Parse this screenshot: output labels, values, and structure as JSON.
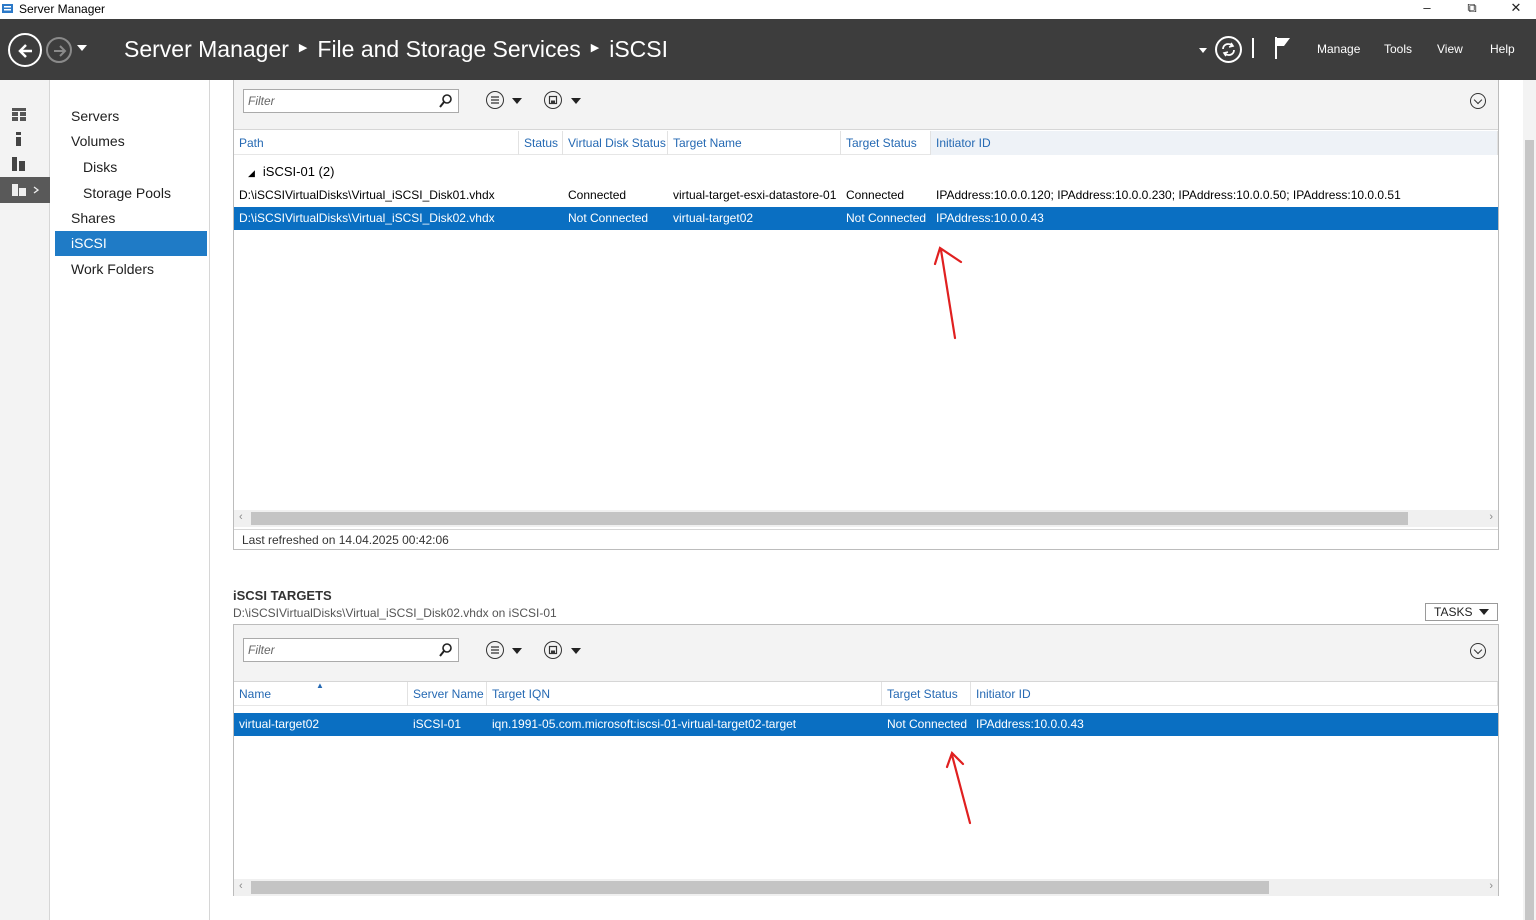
{
  "window": {
    "title": "Server Manager",
    "controls": [
      "–",
      "⧉",
      "✕"
    ]
  },
  "header": {
    "breadcrumb": [
      "Server Manager",
      "File and Storage Services",
      "iSCSI"
    ],
    "menu": [
      "Manage",
      "Tools",
      "View",
      "Help"
    ]
  },
  "nav": {
    "items": [
      {
        "label": "Servers",
        "sub": false,
        "active": false
      },
      {
        "label": "Volumes",
        "sub": false,
        "active": false
      },
      {
        "label": "Disks",
        "sub": true,
        "active": false
      },
      {
        "label": "Storage Pools",
        "sub": true,
        "active": false
      },
      {
        "label": "Shares",
        "sub": false,
        "active": false
      },
      {
        "label": "iSCSI",
        "sub": false,
        "active": true
      },
      {
        "label": "Work Folders",
        "sub": false,
        "active": false
      }
    ]
  },
  "virtual_disks": {
    "filter_placeholder": "Filter",
    "columns": [
      "Path",
      "Status",
      "Virtual Disk Status",
      "Target Name",
      "Target Status",
      "Initiator ID"
    ],
    "group": "iSCSI-01 (2)",
    "rows": [
      {
        "path": "D:\\iSCSIVirtualDisks\\Virtual_iSCSI_Disk01.vhdx",
        "status": "",
        "vd_status": "Connected",
        "target_name": "virtual-target-esxi-datastore-01",
        "target_status": "Connected",
        "initiator": "IPAddress:10.0.0.120; IPAddress:10.0.0.230; IPAddress:10.0.0.50; IPAddress:10.0.0.51",
        "selected": false
      },
      {
        "path": "D:\\iSCSIVirtualDisks\\Virtual_iSCSI_Disk02.vhdx",
        "status": "",
        "vd_status": "Not Connected",
        "target_name": "virtual-target02",
        "target_status": "Not Connected",
        "initiator": "IPAddress:10.0.0.43",
        "selected": true
      }
    ],
    "last_refreshed": "Last refreshed on 14.04.2025 00:42:06"
  },
  "targets": {
    "title": "iSCSI TARGETS",
    "subtitle": "D:\\iSCSIVirtualDisks\\Virtual_iSCSI_Disk02.vhdx on iSCSI-01",
    "tasks_label": "TASKS",
    "filter_placeholder": "Filter",
    "columns": [
      "Name",
      "Server Name",
      "Target IQN",
      "Target Status",
      "Initiator ID"
    ],
    "rows": [
      {
        "name": "virtual-target02",
        "server": "iSCSI-01",
        "iqn": "iqn.1991-05.com.microsoft:iscsi-01-virtual-target02-target",
        "target_status": "Not Connected",
        "initiator": "IPAddress:10.0.0.43",
        "selected": true
      }
    ]
  },
  "colors": {
    "header_bg": "#3d3d3d",
    "selection": "#0a6fc2",
    "nav_active": "#1f7bc6",
    "column_header_text": "#2569b3",
    "annotation": "#e02020"
  },
  "icons": [
    "back-icon",
    "forward-icon",
    "refresh-icon",
    "flag-icon",
    "dashboard-icon",
    "local-server-icon",
    "all-servers-icon",
    "file-storage-icon",
    "search-icon",
    "view-options-icon",
    "save-query-icon"
  ]
}
